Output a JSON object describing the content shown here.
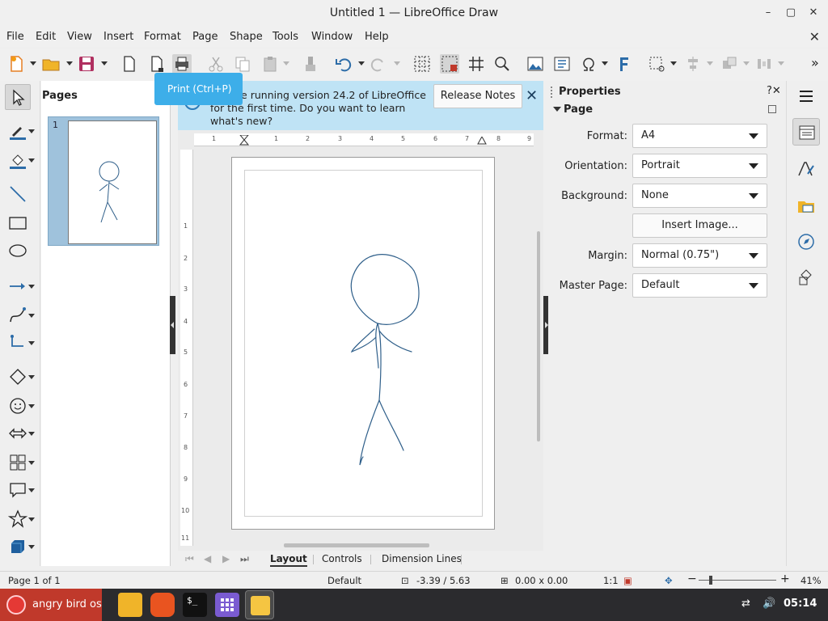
{
  "window": {
    "title": "Untitled 1 — LibreOffice Draw",
    "controls": {
      "minimize": "–",
      "maximize": "▢",
      "close": "✕"
    }
  },
  "menubar": {
    "items": [
      "File",
      "Edit",
      "View",
      "Insert",
      "Format",
      "Page",
      "Shape",
      "Tools",
      "Window",
      "Help"
    ],
    "close_doc": "✕"
  },
  "toolbar": {
    "tooltip": "Print (Ctrl+P)",
    "overflow": "»"
  },
  "pages_pane": {
    "title": "Pages",
    "thumb_number": "1"
  },
  "infobar": {
    "message": "You are running version 24.2 of LibreOffice for the first time. Do you want to learn what's new?",
    "release_notes": "Release Notes",
    "close": "✕"
  },
  "rulers": {
    "h_ticks": [
      "1",
      "1",
      "2",
      "3",
      "4",
      "5",
      "6",
      "7",
      "8",
      "9"
    ],
    "v_ticks": [
      "1",
      "2",
      "3",
      "4",
      "5",
      "6",
      "7",
      "8",
      "9",
      "10",
      "11"
    ]
  },
  "tabs": {
    "items": [
      "Layout",
      "Controls",
      "Dimension Lines"
    ],
    "active": "Layout"
  },
  "properties": {
    "title": "Properties",
    "help": "?",
    "close": "✕",
    "section": "Page",
    "format_label": "Format:",
    "format_value": "A4",
    "orientation_label": "Orientation:",
    "orientation_value": "Portrait",
    "background_label": "Background:",
    "background_value": "None",
    "insert_image": "Insert Image...",
    "margin_label": "Margin:",
    "margin_value": "Normal (0.75\")",
    "master_label": "Master Page:",
    "master_value": "Default"
  },
  "statusbar": {
    "page": "Page 1 of 1",
    "master": "Default",
    "position": "-3.39 / 5.63",
    "size": "0.00 x 0.00",
    "scale": "1:1",
    "zoom": "41%",
    "zoom_minus": "−",
    "zoom_plus": "+"
  },
  "taskbar": {
    "start_label": "angry bird os",
    "time": "05:14"
  },
  "colors": {
    "accent": "#3daee9",
    "infobar_bg": "#bfe3f5",
    "sketch_stroke": "#2f5f8a",
    "taskbar_bg": "#2b2b2e",
    "start_bg": "#c0392b"
  }
}
